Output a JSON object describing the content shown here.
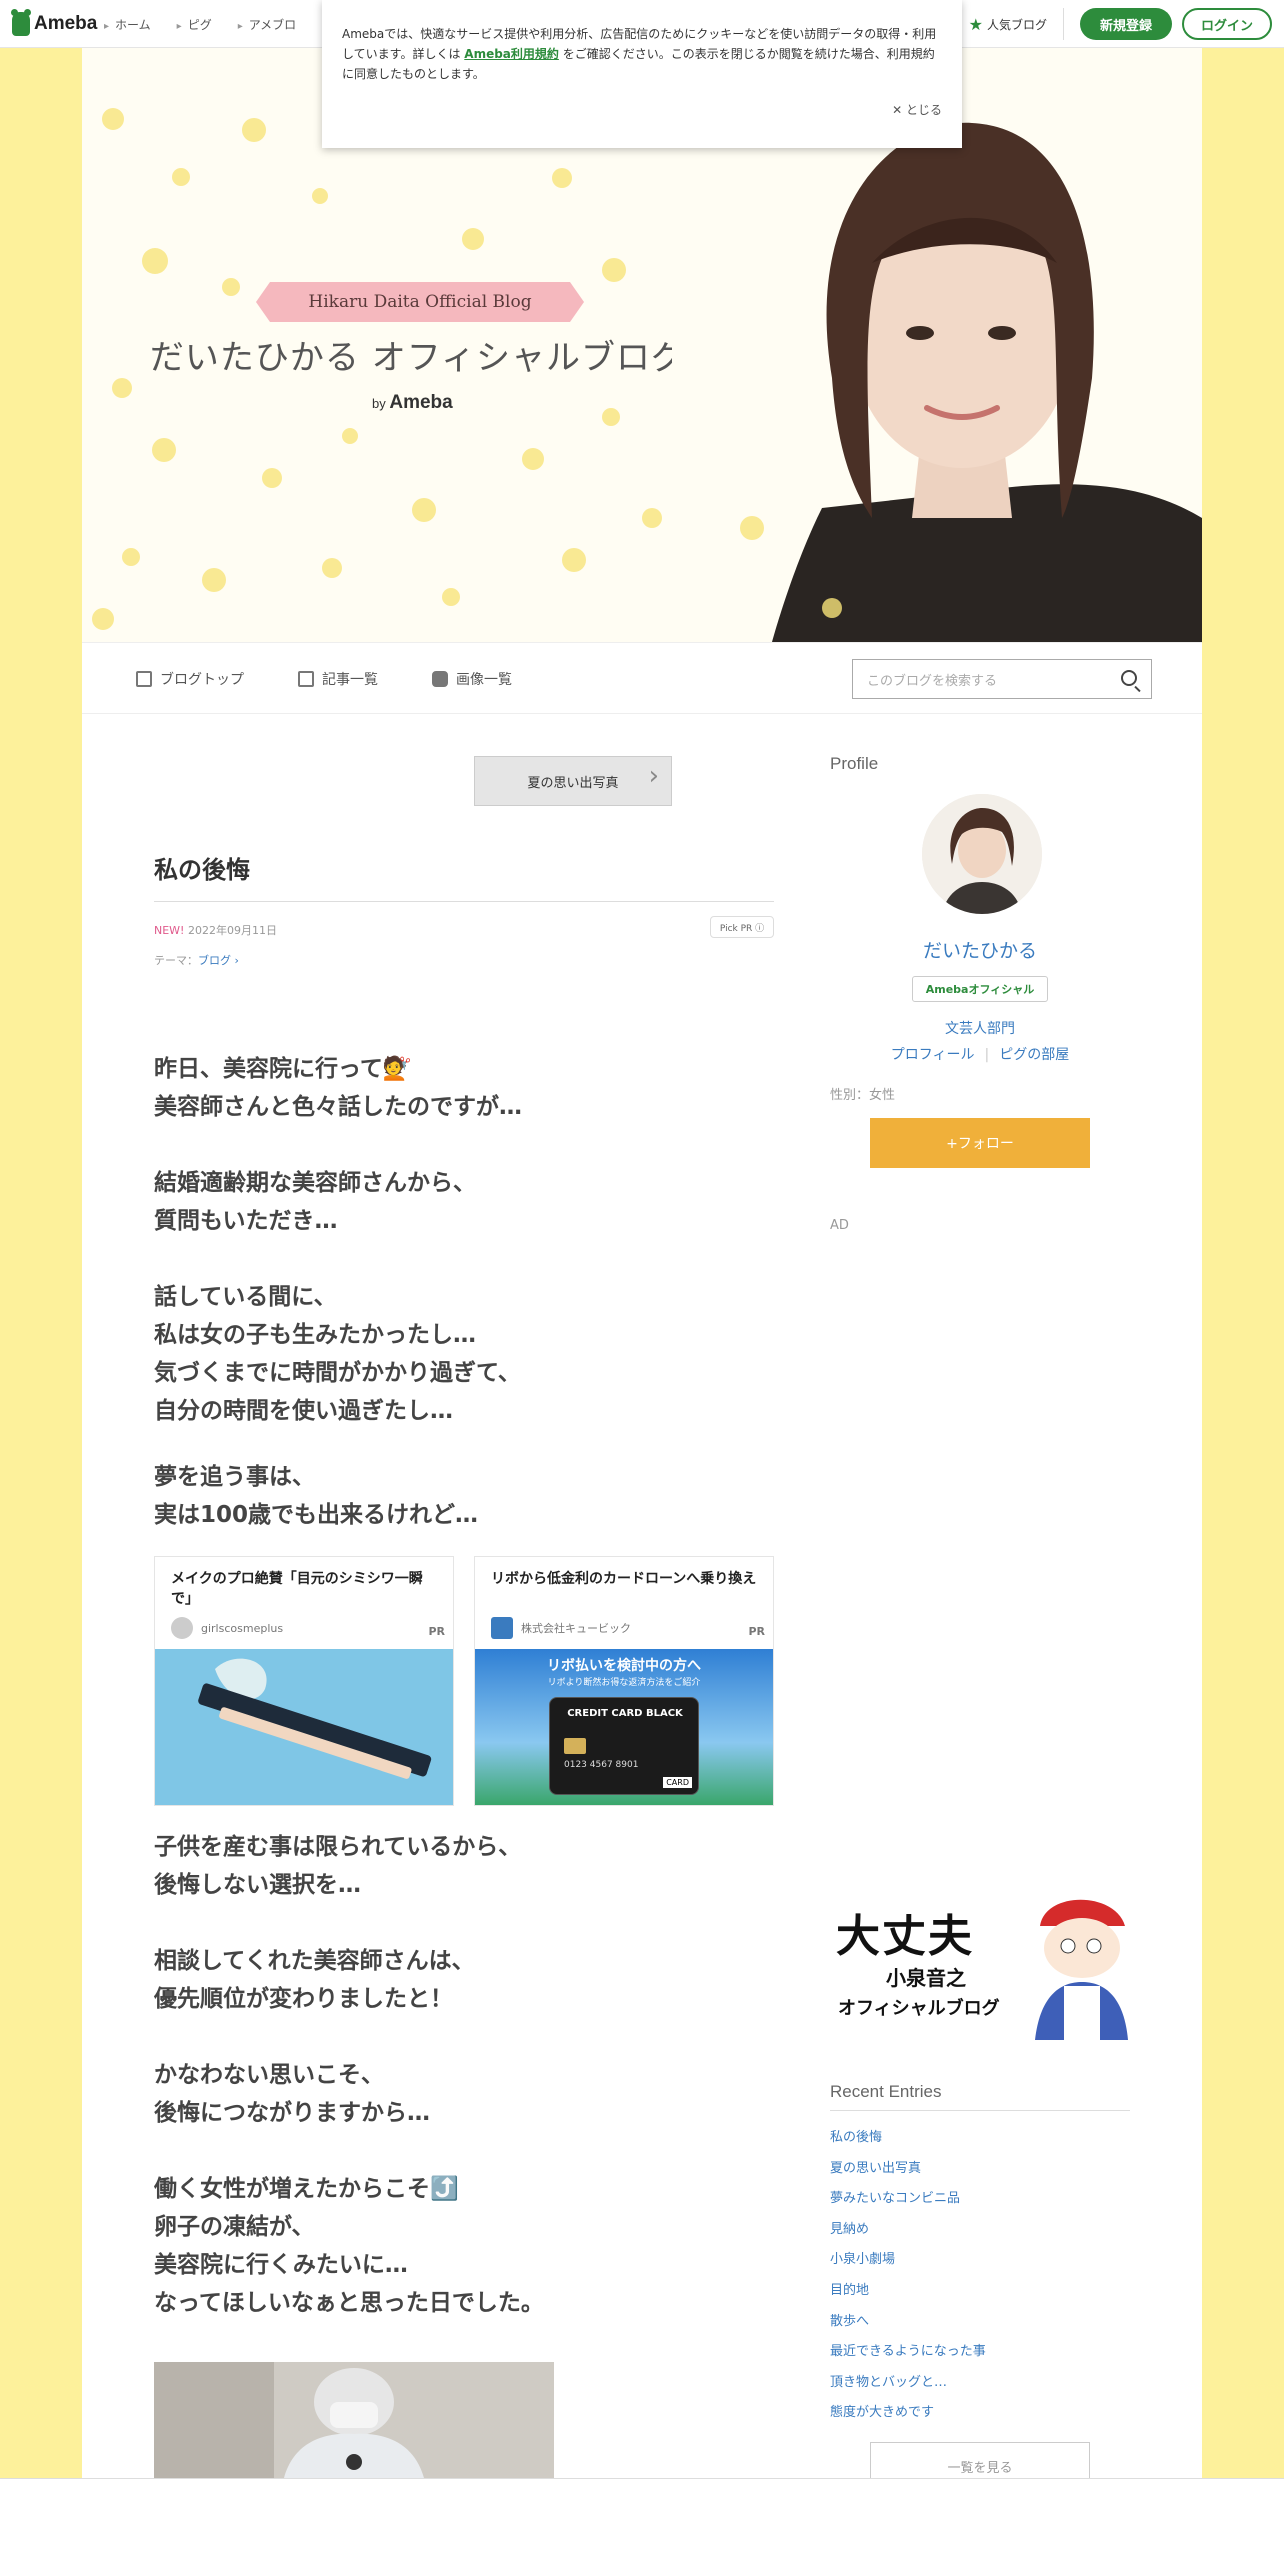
{
  "topbar": {
    "logo": "Ameba",
    "nav": [
      "ホーム",
      "ピグ",
      "アメブロ"
    ],
    "popular": "人気ブログ",
    "signup": "新規登録",
    "login": "ログイン"
  },
  "cookie": {
    "text1": "Amebaでは、快適なサービス提供や利用分析、広告配信のためにクッキーなどを使い訪問データの取得・利用しています。詳しくは",
    "link": "Ameba利用規約",
    "text2": "をご確認ください。この表示を閉じるか閲覧を続けた場合、利用規約に同意したものとします。",
    "close": "✕ とじる"
  },
  "header": {
    "ribbon": "Hikaru Daita Official Blog",
    "title": "だいたひかる オフィシャルブログ",
    "by": "by",
    "brand": "Ameba"
  },
  "blognav": {
    "items": [
      "ブログトップ",
      "記事一覧",
      "画像一覧"
    ],
    "search_placeholder": "このブログを検索する"
  },
  "entry": {
    "prev": "夏の思い出写真",
    "title": "私の後悔",
    "new": "NEW!",
    "date": "2022年09月11日",
    "pickpr": "Pick PR ⓘ",
    "theme_label": "テーマ：",
    "theme": "ブログ ›",
    "p1": [
      "昨日、美容院に行って💇",
      "美容師さんと色々話したのですが…"
    ],
    "p2": [
      "結婚適齢期な美容師さんから、",
      "質問もいただき…"
    ],
    "p3": [
      "話している間に、",
      "私は女の子も生みたかったし…",
      "気づくまでに時間がかかり過ぎて、",
      "自分の時間を使い過ぎたし…"
    ],
    "p4": [
      "夢を追う事は、",
      "実は100歳でも出来るけれど…"
    ],
    "p5": [
      "子供を産む事は限られているから、",
      "後悔しない選択を…"
    ],
    "p6": [
      "相談してくれた美容師さんは、",
      "優先順位が変わりましたと！"
    ],
    "p7": [
      "かなわない思いこそ、",
      "後悔につながりますから…"
    ],
    "p8": [
      "働く女性が増えたからこそ⤴️",
      "卵子の凍結が、",
      "美容院に行くみたいに…",
      "なってほしいなぁと思った日でした。"
    ]
  },
  "ads": [
    {
      "title": "メイクのプロ絶賛「目元のシミシワ一瞬で」",
      "source": "girlscosmeplus",
      "pr": "PR"
    },
    {
      "title": "リボから低金利のカードローンへ乗り換え",
      "source": "株式会社キュービック",
      "pr": "PR",
      "card_head": "リボ払いを検討中の方へ",
      "card_sub": "リボより断然お得な返済方法をご紹介",
      "card_label": "CREDIT CARD BLACK",
      "card_num": "0123 4567 8901",
      "card_tag": "CARD"
    }
  ],
  "sidebar": {
    "profile_heading": "Profile",
    "name": "だいたひかる",
    "official": "Amebaオフィシャル",
    "category": "文芸人部門",
    "link_profile": "プロフィール",
    "link_pig": "ピグの部屋",
    "gender": "性別：女性",
    "follow": "+フォロー",
    "ad_label": "AD",
    "banner": {
      "big": "大丈夫",
      "name": "小泉音之",
      "sub": "オフィシャルブログ"
    },
    "recent_heading": "Recent Entries",
    "recent": [
      "私の後悔",
      "夏の思い出写真",
      "夢みたいなコンビニ品",
      "見納め",
      "小泉小劇場",
      "目的地",
      "散歩へ",
      "最近できるようになった事",
      "頂き物とバッグと…",
      "態度が大きめです"
    ],
    "more": "一覧を見る"
  },
  "colors": {
    "ameba_green": "#2d8c3c",
    "follow": "#f0b03a",
    "link": "#3a7bbf",
    "bg": "#fdf19b"
  }
}
